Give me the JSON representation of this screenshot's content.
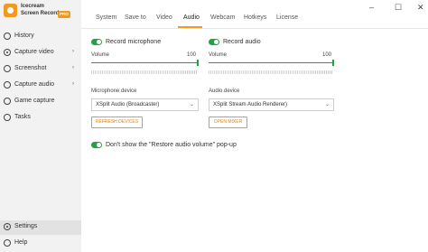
{
  "app": {
    "brand_line1": "Icecream",
    "brand_line2": "Screen Recorder",
    "pro_badge": "PRO"
  },
  "sidebar": {
    "items": [
      {
        "label": "History"
      },
      {
        "label": "Capture video",
        "chevron": "›"
      },
      {
        "label": "Screenshot",
        "chevron": "›"
      },
      {
        "label": "Capture audio",
        "chevron": "›"
      },
      {
        "label": "Game capture"
      },
      {
        "label": "Tasks"
      }
    ],
    "settings_label": "Settings",
    "help_label": "Help"
  },
  "tabs": [
    "System",
    "Save to",
    "Video",
    "Audio",
    "Webcam",
    "Hotkeys",
    "License"
  ],
  "active_tab": "Audio",
  "window_controls": {
    "minimize": "–",
    "maximize": "☐",
    "close": "✕"
  },
  "microphone": {
    "toggle_label": "Record microphone",
    "enabled": true,
    "volume_label": "Volume",
    "volume_value": "100",
    "device_label": "Microphone device",
    "device_value": "XSplit Audio (Broadcaster)",
    "button_label": "REFRESH DEVICES"
  },
  "audio": {
    "toggle_label": "Record audio",
    "enabled": true,
    "volume_label": "Volume",
    "volume_value": "100",
    "device_label": "Audio device",
    "device_value": "XSplit Stream Audio Renderer)",
    "button_label": "OPEN MIXER"
  },
  "popup_option": {
    "label": "Don't show the \"Restore audio volume\" pop-up",
    "enabled": true
  },
  "colors": {
    "accent": "#f39a1e",
    "toggle_on": "#24a148"
  }
}
